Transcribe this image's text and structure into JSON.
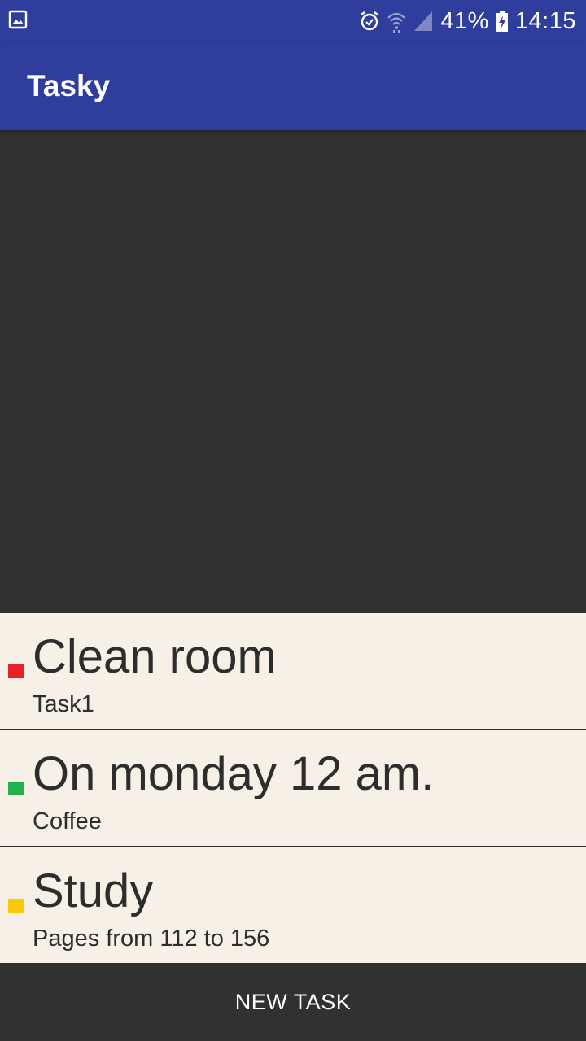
{
  "status_bar": {
    "left_icon": "image-notification-icon",
    "icons": [
      "alarm-icon",
      "wifi-icon",
      "signal-icon",
      "battery-charging-icon"
    ],
    "battery_percent": "41%",
    "time": "14:15"
  },
  "app_bar": {
    "title": "Tasky"
  },
  "tasks": [
    {
      "title": "Clean room",
      "subtitle": "Task1",
      "priority_color": "#e8202a"
    },
    {
      "title": "On monday 12 am.",
      "subtitle": "Coffee",
      "priority_color": "#22b14c"
    },
    {
      "title": "Study",
      "subtitle": "Pages from 112 to 156",
      "priority_color": "#fdc80b"
    }
  ],
  "footer": {
    "new_task_label": "NEW TASK"
  },
  "colors": {
    "primary": "#2f3d9c",
    "background_dark": "#303131",
    "list_background": "#f6f0e6",
    "text_dark": "#2d2d2d"
  }
}
